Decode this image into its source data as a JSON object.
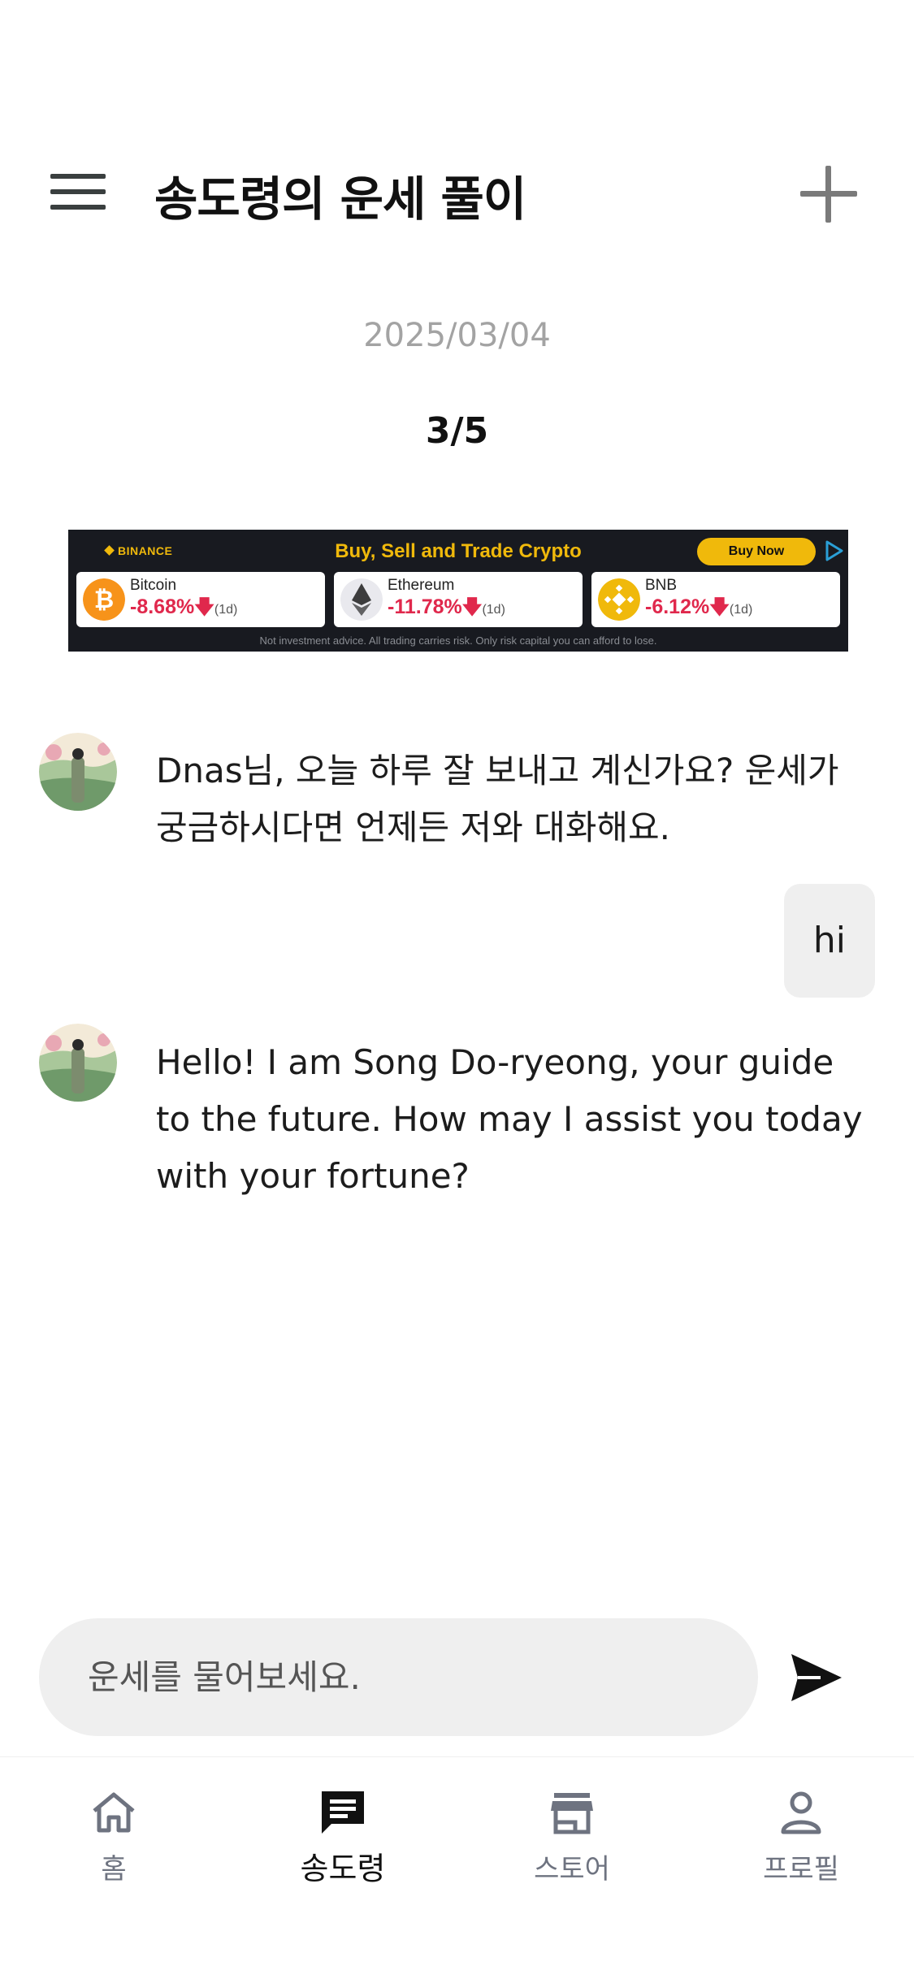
{
  "header": {
    "title": "송도령의 운세 풀이"
  },
  "chat": {
    "date": "2025/03/04",
    "counter": "3/5",
    "messages": [
      {
        "role": "bot",
        "text": "Dnas님, 오늘 하루 잘 보내고 계신가요? 운세가 궁금하시다면 언제든 저와 대화해요."
      },
      {
        "role": "user",
        "text": "hi"
      },
      {
        "role": "bot",
        "text": "Hello! I am Song Do-ryeong, your guide to the future. How may I assist you today with your fortune?"
      }
    ]
  },
  "ad": {
    "brand": "BINANCE",
    "headline": "Buy, Sell and Trade Crypto",
    "cta": "Buy Now",
    "disclaimer": "Not investment advice. All trading carries risk. Only risk capital you can afford to lose.",
    "coins": [
      {
        "name": "Bitcoin",
        "change": "-8.68%",
        "period": "(1d)"
      },
      {
        "name": "Ethereum",
        "change": "-11.78%",
        "period": "(1d)"
      },
      {
        "name": "BNB",
        "change": "-6.12%",
        "period": "(1d)"
      }
    ],
    "colors": {
      "accent": "#f0b90b",
      "negative": "#e0284c",
      "background": "#181a20"
    }
  },
  "composer": {
    "placeholder": "운세를 물어보세요."
  },
  "tabbar": {
    "items": [
      {
        "label": "홈",
        "icon": "home-icon"
      },
      {
        "label": "송도령",
        "icon": "chat-icon",
        "active": true
      },
      {
        "label": "스토어",
        "icon": "store-icon"
      },
      {
        "label": "프로필",
        "icon": "profile-icon"
      }
    ]
  }
}
